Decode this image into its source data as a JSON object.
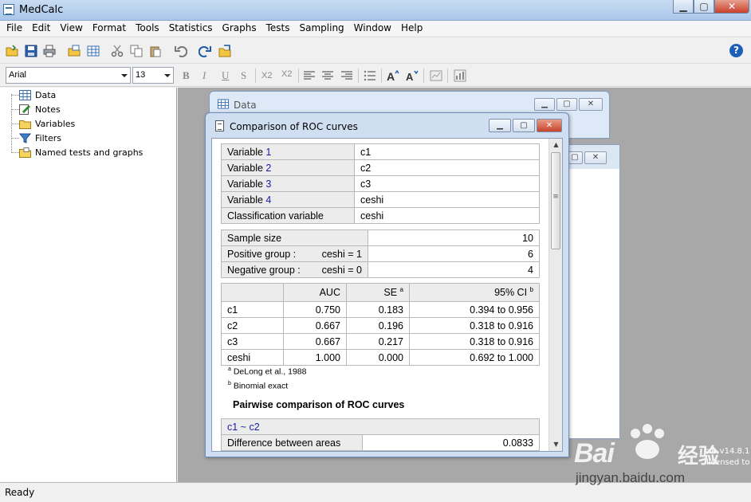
{
  "app": {
    "title": "MedCalc"
  },
  "menu": [
    "File",
    "Edit",
    "View",
    "Format",
    "Tools",
    "Statistics",
    "Graphs",
    "Tests",
    "Sampling",
    "Window",
    "Help"
  ],
  "toolbar": {
    "icons": [
      "open-folder-icon",
      "save-icon",
      "print-icon",
      "open-data-icon",
      "spreadsheet-icon",
      "cut-icon",
      "copy-icon",
      "paste-icon",
      "undo-icon",
      "redo-icon",
      "export-icon"
    ],
    "help_label": "?"
  },
  "format": {
    "font": "Arial",
    "size": "13",
    "bold": "B",
    "italic": "I",
    "underline": "U",
    "strike": "S",
    "subscript": "X2",
    "superscript": "X2"
  },
  "tree": {
    "items": [
      "Data",
      "Notes",
      "Variables",
      "Filters",
      "Named tests and graphs"
    ]
  },
  "data_window": {
    "title": "Data"
  },
  "roc_window": {
    "title": "Comparison of ROC curves",
    "variables": [
      {
        "label": "Variable ",
        "num": "1",
        "value": "c1"
      },
      {
        "label": "Variable ",
        "num": "2",
        "value": "c2"
      },
      {
        "label": "Variable ",
        "num": "3",
        "value": "c3"
      },
      {
        "label": "Variable ",
        "num": "4",
        "value": "ceshi"
      },
      {
        "label": "Classification variable",
        "num": "",
        "value": "ceshi"
      }
    ],
    "sample": {
      "size_label": "Sample size",
      "size_value": "10",
      "pos_label": "Positive group :",
      "pos_cond": "ceshi = 1",
      "pos_value": "6",
      "neg_label": "Negative group :",
      "neg_cond": "ceshi = 0",
      "neg_value": "4"
    },
    "auc_headers": {
      "auc": "AUC",
      "se": "SE",
      "se_sup": "a",
      "ci": "95% CI",
      "ci_sup": "b"
    },
    "auc_rows": [
      {
        "name": "c1",
        "auc": "0.750",
        "se": "0.183",
        "ci": "0.394 to 0.956"
      },
      {
        "name": "c2",
        "auc": "0.667",
        "se": "0.196",
        "ci": "0.318 to 0.916"
      },
      {
        "name": "c3",
        "auc": "0.667",
        "se": "0.217",
        "ci": "0.318 to 0.916"
      },
      {
        "name": "ceshi",
        "auc": "1.000",
        "se": "0.000",
        "ci": "0.692 to 1.000"
      }
    ],
    "footnotes": [
      {
        "sup": "a",
        "text": "DeLong et al., 1988"
      },
      {
        "sup": "b",
        "text": "Binomial exact"
      }
    ],
    "pairwise_title": "Pairwise comparison of ROC curves",
    "pair_header": "c1 ~ c2",
    "diff_label": "Difference between areas",
    "diff_value": "0.0833"
  },
  "status": {
    "text": "Ready"
  },
  "watermark": {
    "logo": "Bai",
    "brand": "经验",
    "url": "jingyan.baidu.com",
    "version": "c® v14.8.1",
    "license": "licensed to"
  }
}
